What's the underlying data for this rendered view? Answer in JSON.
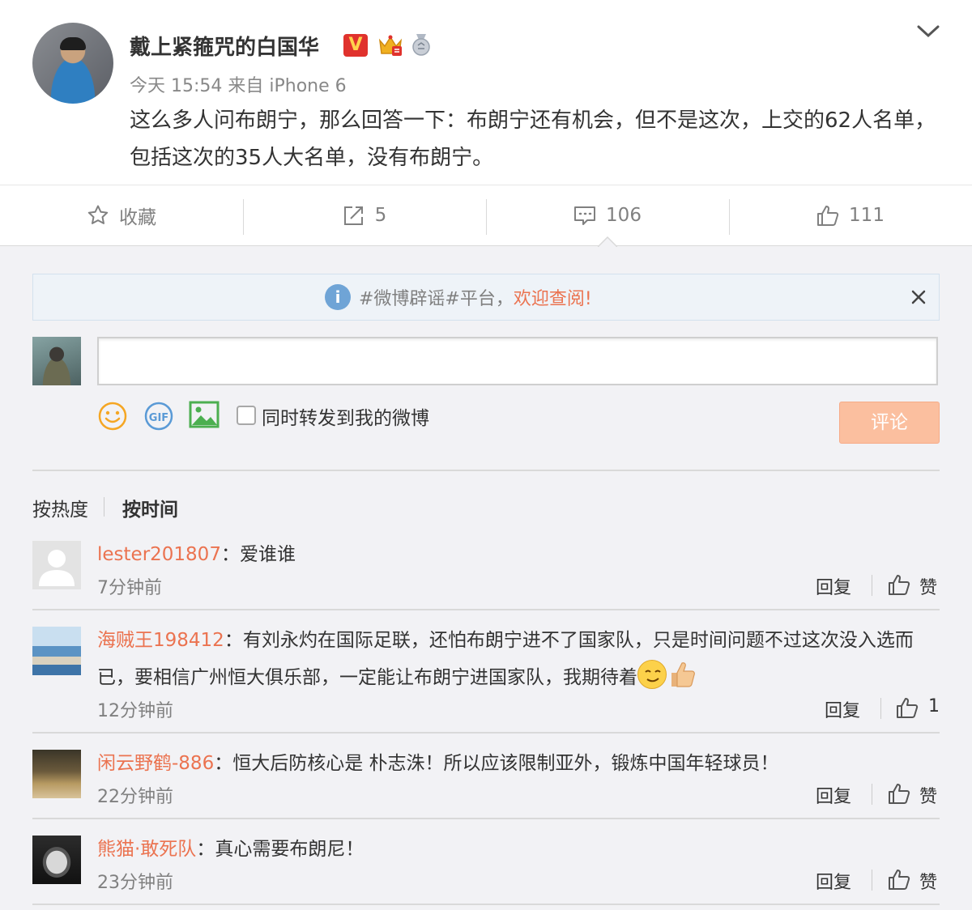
{
  "post": {
    "username": "戴上紧箍咒的白国华",
    "badge_v": "V",
    "meta": "今天 15:54 来自 iPhone 6",
    "text": "这么多人问布朗宁，那么回答一下：布朗宁还有机会，但不是这次，上交的62人名单，包括这次的35人大名单，没有布朗宁。"
  },
  "actions": {
    "favorite": "收藏",
    "repost": "5",
    "comment": "106",
    "like": "111"
  },
  "notice": {
    "prefix": "#微博辟谣#平台，",
    "link": "欢迎查阅!"
  },
  "composer": {
    "input_value": "",
    "repost_label": "同时转发到我的微博",
    "submit_label": "评论"
  },
  "sort": {
    "hot": "按热度",
    "time": "按时间"
  },
  "comments": [
    {
      "user": "lester201807",
      "sep": "：",
      "text": "爱谁谁",
      "time": "7分钟前",
      "reply": "回复",
      "like": "赞"
    },
    {
      "user": "海贼王198412",
      "sep": "：",
      "text": "有刘永灼在国际足联，还怕布朗宁进不了国家队，只是时间问题不过这次没入选而已，要相信广州恒大俱乐部，一定能让布朗宁进国家队，我期待着",
      "time": "12分钟前",
      "reply": "回复",
      "like": "1"
    },
    {
      "user": "闲云野鹤-886",
      "sep": "：",
      "text": "恒大后防核心是 朴志洙！所以应该限制亚外，锻炼中国年轻球员！",
      "time": "22分钟前",
      "reply": "回复",
      "like": "赞"
    },
    {
      "user": "熊猫·敢死队",
      "sep": "：",
      "text": "真心需要布朗尼！",
      "time": "23分钟前",
      "reply": "回复",
      "like": "赞"
    }
  ],
  "colors": {
    "link_orange": "#eb7350",
    "submit_bg": "#fbbf9f",
    "notice_bg": "#eef3f8"
  }
}
